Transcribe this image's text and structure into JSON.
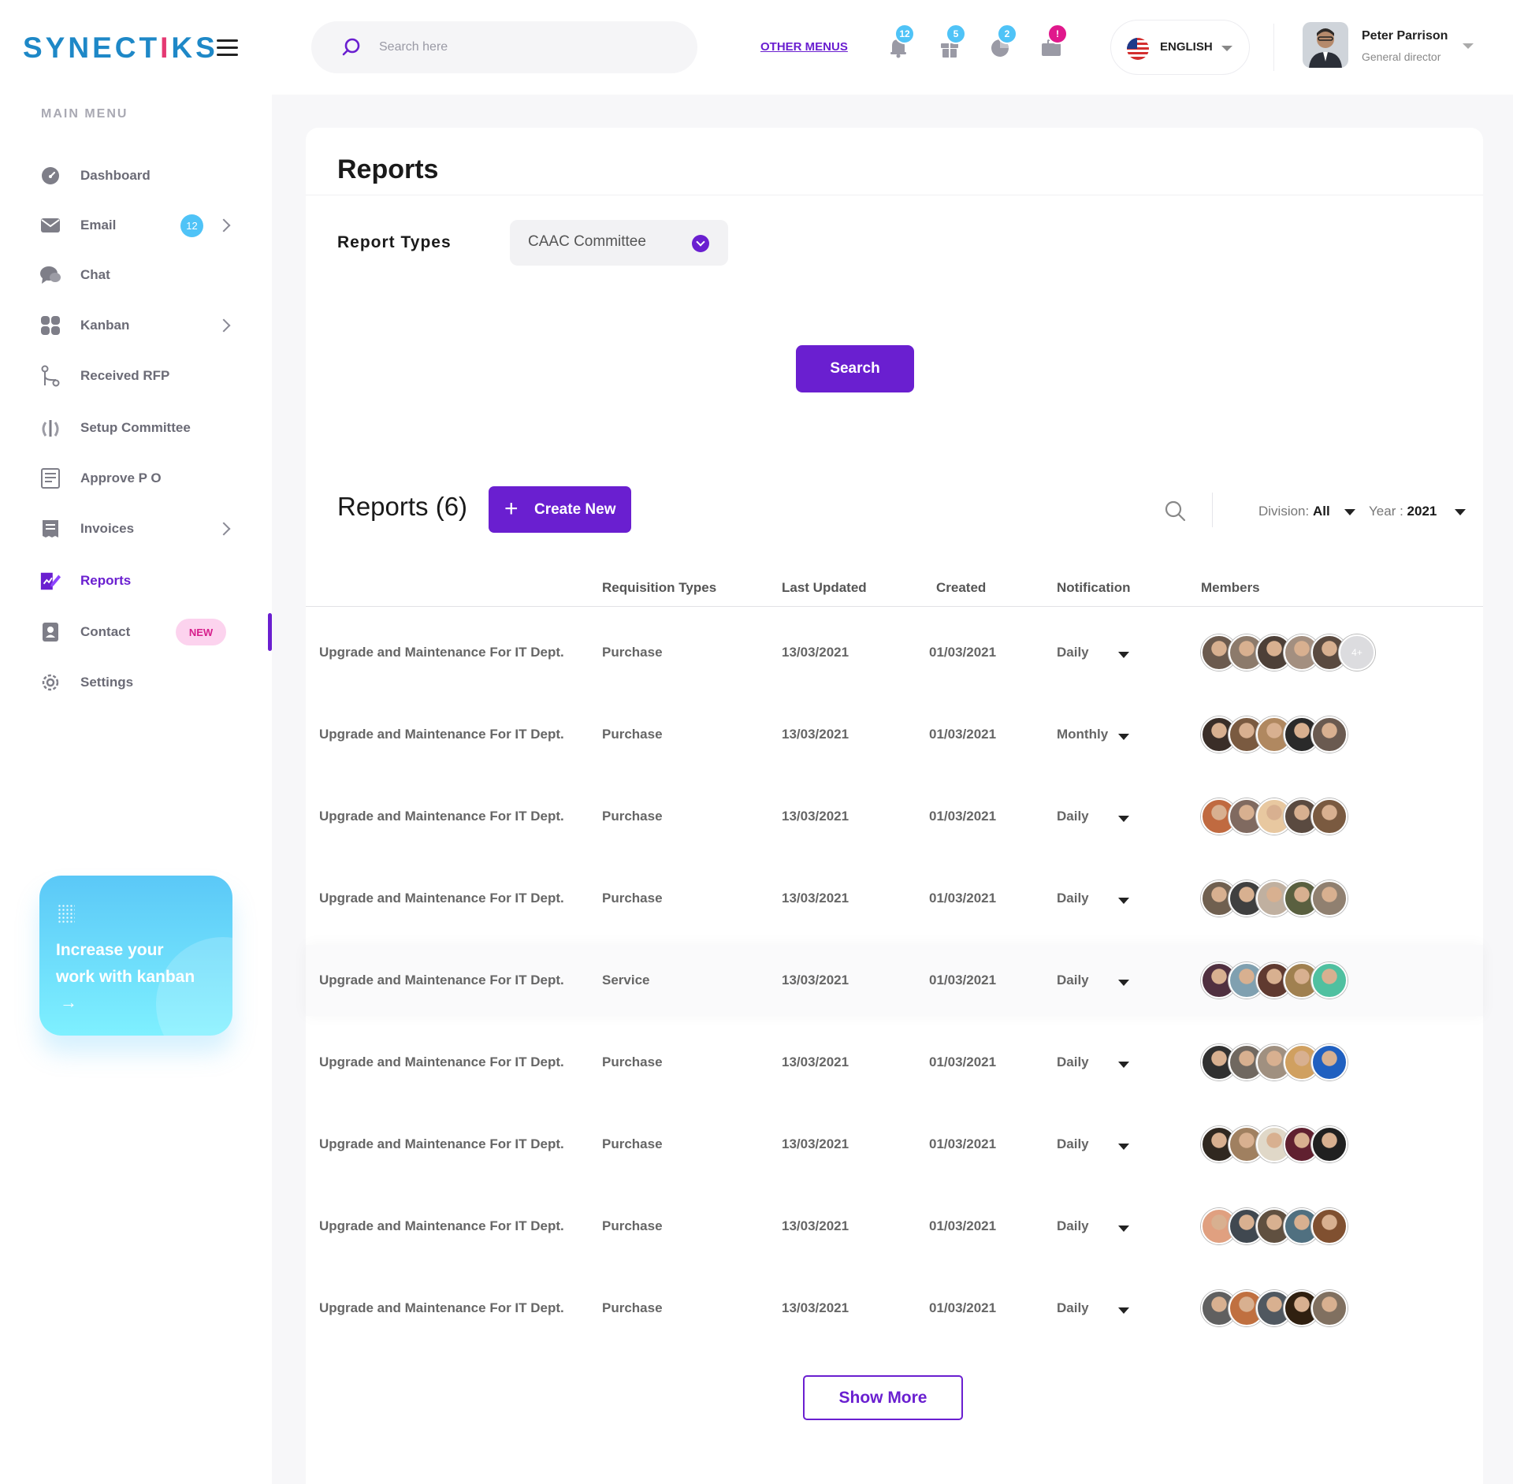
{
  "brand": {
    "name_a": "SYNECT",
    "name_b": "I",
    "name_c": "KS"
  },
  "sidebar": {
    "title": "MAIN MENU",
    "items": [
      {
        "label": "Dashboard",
        "icon": "dashboard-icon"
      },
      {
        "label": "Email",
        "icon": "email-icon",
        "count": "12"
      },
      {
        "label": "Chat",
        "icon": "chat-icon"
      },
      {
        "label": "Kanban",
        "icon": "kanban-icon"
      },
      {
        "label": "Received RFP",
        "icon": "git-branch-icon"
      },
      {
        "label": "Setup Committee",
        "icon": "committee-icon"
      },
      {
        "label": "Approve P O",
        "icon": "approve-icon"
      },
      {
        "label": "Invoices",
        "icon": "invoice-icon"
      },
      {
        "label": "Reports",
        "icon": "reports-icon"
      },
      {
        "label": "Contact",
        "icon": "contact-icon",
        "badge": "NEW"
      },
      {
        "label": "Settings",
        "icon": "gear-icon"
      }
    ],
    "promo": {
      "line1": "Increase your",
      "line2": "work with kanban",
      "arrow": "→"
    }
  },
  "topbar": {
    "search_placeholder": "Search here",
    "other_menus": "OTHER MENUS",
    "badges": {
      "bell": "12",
      "gift": "5",
      "chart": "2",
      "box": "!"
    },
    "language": "ENGLISH",
    "user": {
      "name": "Peter Parrison",
      "role": "General director"
    }
  },
  "page": {
    "title": "Reports",
    "report_types_label": "Report Types",
    "report_type_value": "CAAC Committee",
    "search_button": "Search",
    "reports_heading": "Reports (6)",
    "create_button": "Create New",
    "create_plus": "+",
    "filters": {
      "division_label": "Division:",
      "division_value": "All",
      "year_label": "Year :",
      "year_value": "2021"
    },
    "columns": [
      "Requisition Types",
      "Last Updated",
      "Created",
      "Notification",
      "Members"
    ],
    "rows": [
      {
        "name": "Upgrade and Maintenance For IT Dept.",
        "type": "Purchase",
        "updated": "13/03/2021",
        "created": "01/03/2021",
        "notification": "Daily",
        "more": "4+"
      },
      {
        "name": "Upgrade and Maintenance For IT Dept.",
        "type": "Purchase",
        "updated": "13/03/2021",
        "created": "01/03/2021",
        "notification": "Monthly"
      },
      {
        "name": "Upgrade and Maintenance For IT Dept.",
        "type": "Purchase",
        "updated": "13/03/2021",
        "created": "01/03/2021",
        "notification": "Daily"
      },
      {
        "name": "Upgrade and Maintenance For IT Dept.",
        "type": "Purchase",
        "updated": "13/03/2021",
        "created": "01/03/2021",
        "notification": "Daily"
      },
      {
        "name": "Upgrade and Maintenance For IT Dept.",
        "type": "Service",
        "updated": "13/03/2021",
        "created": "01/03/2021",
        "notification": "Daily"
      },
      {
        "name": "Upgrade and Maintenance For IT Dept.",
        "type": "Purchase",
        "updated": "13/03/2021",
        "created": "01/03/2021",
        "notification": "Daily"
      },
      {
        "name": "Upgrade and Maintenance For IT Dept.",
        "type": "Purchase",
        "updated": "13/03/2021",
        "created": "01/03/2021",
        "notification": "Daily"
      },
      {
        "name": "Upgrade and Maintenance For IT Dept.",
        "type": "Purchase",
        "updated": "13/03/2021",
        "created": "01/03/2021",
        "notification": "Daily"
      },
      {
        "name": "Upgrade and Maintenance For IT Dept.",
        "type": "Purchase",
        "updated": "13/03/2021",
        "created": "01/03/2021",
        "notification": "Daily"
      }
    ],
    "show_more": "Show More"
  },
  "colors": {
    "accent": "#6a1fd0",
    "brand": "#1e88c7",
    "info_badge": "#4fc3f7",
    "alert_badge": "#e0188c"
  }
}
